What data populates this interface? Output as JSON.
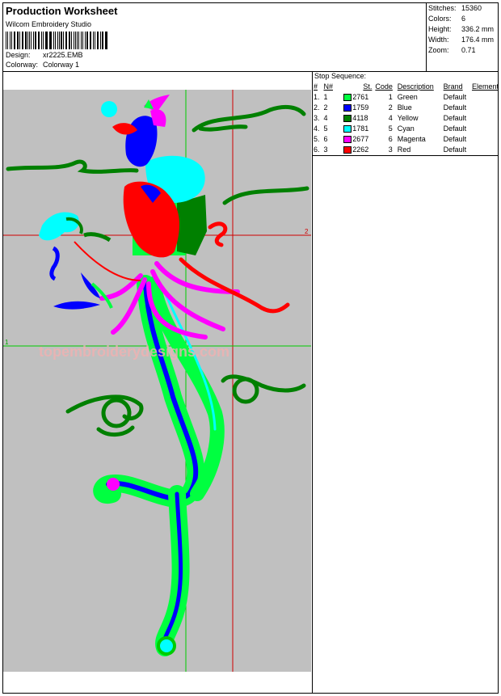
{
  "header": {
    "title": "Production Worksheet",
    "software": "Wilcom  Embroidery Studio",
    "design_label": "Design:",
    "design_value": "xr2225.EMB",
    "colorway_label": "Colorway:",
    "colorway_value": "Colorway  1"
  },
  "stats": [
    {
      "label": "Stitches:",
      "value": "15360"
    },
    {
      "label": "Colors:",
      "value": "6"
    },
    {
      "label": "Height:",
      "value": "336.2 mm"
    },
    {
      "label": "Width:",
      "value": "176.4 mm"
    },
    {
      "label": "Zoom:",
      "value": "0.71"
    }
  ],
  "stop_sequence": {
    "title": "Stop Sequence:",
    "columns": [
      "#",
      "N#",
      "St.",
      "Code",
      "Description",
      "Brand",
      "Element"
    ],
    "rows": [
      {
        "num": "1.",
        "n": "1",
        "st": "2761",
        "code": "1",
        "desc": "Green",
        "brand": "Default",
        "color": "#00ff40"
      },
      {
        "num": "2.",
        "n": "2",
        "st": "1759",
        "code": "2",
        "desc": "Blue",
        "brand": "Default",
        "color": "#0000ff"
      },
      {
        "num": "3.",
        "n": "4",
        "st": "4118",
        "code": "4",
        "desc": "Yellow",
        "brand": "Default",
        "color": "#008000"
      },
      {
        "num": "4.",
        "n": "5",
        "st": "1781",
        "code": "5",
        "desc": "Cyan",
        "brand": "Default",
        "color": "#00ffff"
      },
      {
        "num": "5.",
        "n": "6",
        "st": "2677",
        "code": "6",
        "desc": "Magenta",
        "brand": "Default",
        "color": "#ff00ff"
      },
      {
        "num": "6.",
        "n": "3",
        "st": "2262",
        "code": "3",
        "desc": "Red",
        "brand": "Default",
        "color": "#ff0000"
      }
    ]
  },
  "canvas": {
    "markers": [
      "1",
      "2"
    ],
    "watermark": "topembroiderydesigns.com"
  }
}
